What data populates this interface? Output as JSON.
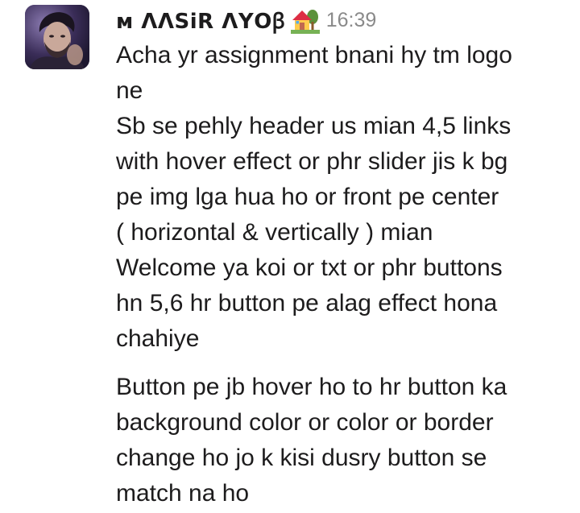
{
  "message": {
    "sender": "ᴍ ꓥꓥꓢiꓣ ꓥꓬꓳꞵ",
    "sender_icon": "house-with-garden-icon",
    "timestamp": "16:39",
    "avatar": "user-avatar-photo",
    "paragraphs": [
      "Acha yr assignment bnani hy tm logo\nne\nSb se pehly header us mian 4,5 links\nwith hover effect or phr slider jis k bg\npe img lga hua ho or front pe center\n( horizontal & vertically ) mian\nWelcome ya koi or txt or phr buttons\nhn 5,6 hr button pe alag effect hona\nchahiye",
      "Button pe jb hover ho to hr button ka\nbackground color or color or border\nchange ho jo k kisi dusry button se\nmatch na ho"
    ]
  }
}
